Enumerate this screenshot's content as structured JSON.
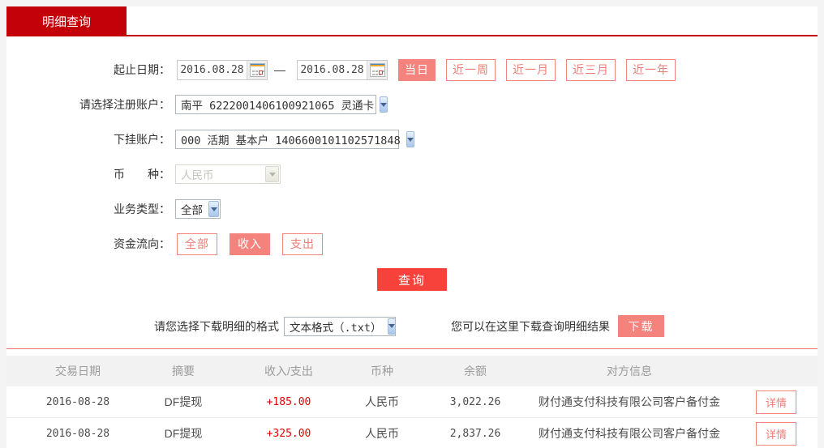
{
  "tab": {
    "label": "明细查询"
  },
  "form": {
    "date_range": {
      "label": "起止日期：",
      "start_value": "2016.08.28",
      "end_value": "2016.08.28",
      "separator": "—"
    },
    "quick_ranges": [
      {
        "label": "当日",
        "active": true
      },
      {
        "label": "近一周",
        "active": false
      },
      {
        "label": "近一月",
        "active": false
      },
      {
        "label": "近三月",
        "active": false
      },
      {
        "label": "近一年",
        "active": false
      }
    ],
    "registered_account": {
      "label": "请选择注册账户：",
      "value": "南平 6222001406100921065 灵通卡"
    },
    "sub_account": {
      "label": "下挂账户：",
      "value": "000 活期 基本户 1406600101102571848"
    },
    "currency": {
      "label": "币　　种：",
      "value": "人民币",
      "disabled": true
    },
    "business_type": {
      "label": "业务类型：",
      "value": "全部"
    },
    "fund_flow": {
      "label": "资金流向：",
      "options": [
        {
          "label": "全部",
          "active": false
        },
        {
          "label": "收入",
          "active": true
        },
        {
          "label": "支出",
          "active": false
        }
      ]
    },
    "query_button": "查询"
  },
  "download": {
    "format_label": "请您选择下载明细的格式",
    "format_value": "文本格式（.txt）",
    "hint": "您可以在这里下载查询明细结果",
    "button": "下载"
  },
  "table": {
    "headers": [
      "交易日期",
      "摘要",
      "收入/支出",
      "币种",
      "余额",
      "对方信息"
    ],
    "detail_label": "详情",
    "rows": [
      {
        "date": "2016-08-28",
        "summary": "DF提现",
        "amount": "+185.00",
        "currency": "人民币",
        "balance": "3,022.26",
        "counterparty": "财付通支付科技有限公司客户备付金"
      },
      {
        "date": "2016-08-28",
        "summary": "DF提现",
        "amount": "+325.00",
        "currency": "人民币",
        "balance": "2,837.26",
        "counterparty": "财付通支付科技有限公司客户备付金"
      }
    ]
  },
  "colors": {
    "brand_red": "#c30109",
    "query_red": "#f6423a",
    "salmon_fill": "#f5837d",
    "salmon_outline": "#f28480",
    "amount_red": "#e60000",
    "header_text": "#9b9b9b",
    "header_bg": "#f2f2f2"
  }
}
